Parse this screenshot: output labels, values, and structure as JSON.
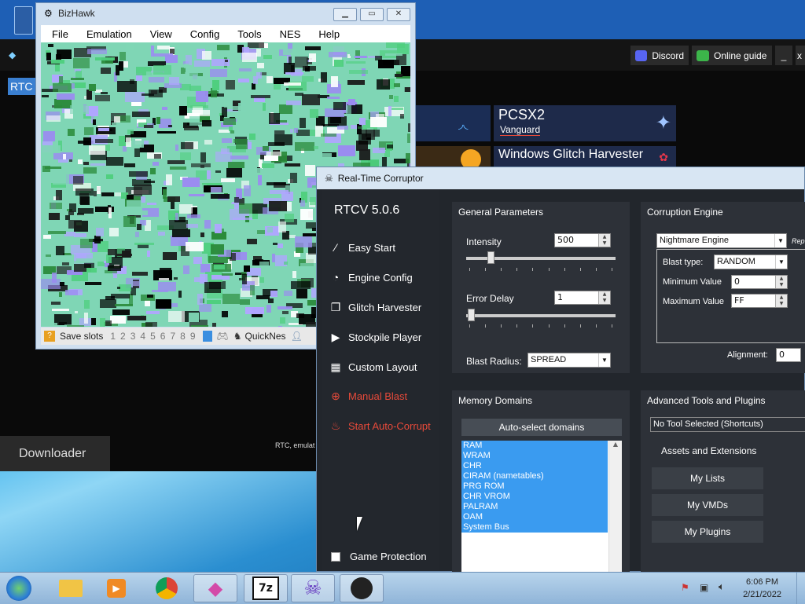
{
  "launcher": {
    "rtc_tag": "RTC",
    "discord_label": "Discord",
    "online_guide_label": "Online guide",
    "minimize_label": "_",
    "close_label": "x",
    "tiles": [
      {
        "title": "PCSX2",
        "subtitle": "Vanguard"
      },
      {
        "title": "Windows Glitch Harvester",
        "subtitle": ""
      }
    ],
    "downloader_label": "Downloader",
    "status_text": "RTC, emulat"
  },
  "bizhawk": {
    "title": "BizHawk",
    "menu": [
      "File",
      "Emulation",
      "View",
      "Config",
      "Tools",
      "NES",
      "Help"
    ],
    "status": {
      "save_slots_label": "Save slots",
      "slots": [
        "1",
        "2",
        "3",
        "4",
        "5",
        "6",
        "7",
        "8",
        "9"
      ],
      "core_label": "QuickNes"
    }
  },
  "rtcv": {
    "window_title": "Real-Time Corruptor",
    "version": "RTCV 5.0.6",
    "nav": [
      {
        "label": "Easy Start",
        "icon": "wand-icon"
      },
      {
        "label": "Engine Config",
        "icon": "gauge-icon"
      },
      {
        "label": "Glitch Harvester",
        "icon": "layers-icon"
      },
      {
        "label": "Stockpile Player",
        "icon": "play-icon"
      },
      {
        "label": "Custom Layout",
        "icon": "grid-icon"
      },
      {
        "label": "Manual Blast",
        "icon": "crosshair-icon"
      },
      {
        "label": "Start Auto-Corrupt",
        "icon": "flame-icon"
      }
    ],
    "game_protection_label": "Game Protection",
    "general": {
      "header": "General Parameters",
      "intensity_label": "Intensity",
      "intensity_value": "500",
      "intensity_level": 0.06,
      "error_delay_label": "Error Delay",
      "error_delay_value": "1",
      "error_delay_level": 0.0,
      "blast_radius_label": "Blast Radius:",
      "blast_radius_value": "SPREAD"
    },
    "engine": {
      "header": "Corruption Engine",
      "engine_value": "Nightmare Engine",
      "rep_label": "Rep",
      "blast_type_label": "Blast type:",
      "blast_type_value": "RANDOM",
      "min_label": "Minimum Value",
      "min_value": "0",
      "max_label": "Maximum Value",
      "max_value": "FF",
      "alignment_label": "Alignment:",
      "alignment_value": "0"
    },
    "memory": {
      "header": "Memory Domains",
      "auto_select_label": "Auto-select domains",
      "domains": [
        "RAM",
        "WRAM",
        "CHR",
        "CIRAM (nametables)",
        "PRG ROM",
        "CHR VROM",
        "PALRAM",
        "OAM",
        "System Bus"
      ]
    },
    "advanced": {
      "header": "Advanced Tools and Plugins",
      "tool_select_value": "No Tool Selected (Shortcuts)",
      "assets_label": "Assets and Extensions",
      "my_lists_label": "My Lists",
      "my_vmds_label": "My VMDs",
      "my_plugins_label": "My Plugins"
    }
  },
  "taskbar": {
    "apps": [
      "start-orb",
      "file-explorer",
      "media-player",
      "chrome",
      "rtc-launcher-gem",
      "7zip",
      "rtcv",
      "bizhawk"
    ],
    "time": "6:06 PM",
    "date": "2/21/2022"
  },
  "colors": {
    "accent_red": "#e84a3a",
    "selection_blue": "#3a9bf0",
    "panel_bg": "#2d3138",
    "window_bg": "#22262c"
  }
}
